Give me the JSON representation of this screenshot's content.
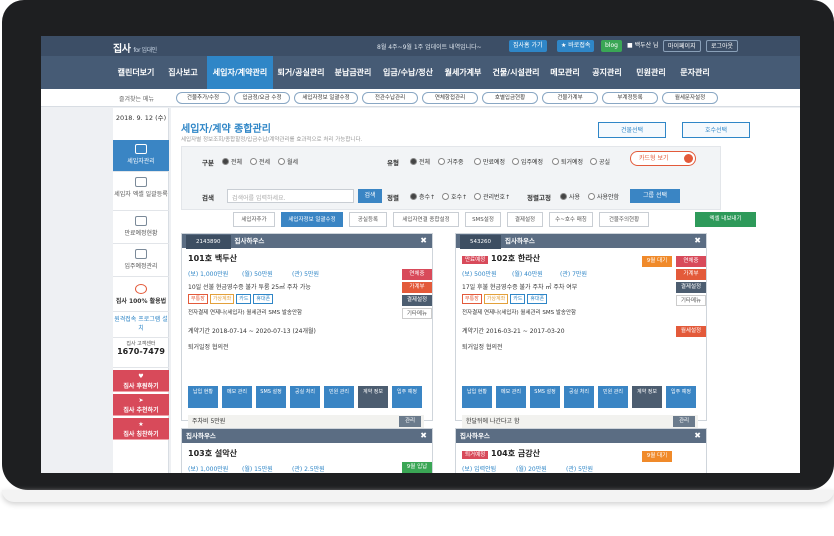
{
  "header": {
    "logo": "집사",
    "logo_sub": "for 임대인",
    "notice": "8월 4주~9월 1주 업데이트 내역입니다~",
    "btn_home": "집사홈 가기",
    "btn_fav": "★ 바로접속",
    "btn_blog": "blog",
    "user": "■ 백두산 님",
    "btn_mypage": "마이페이지",
    "btn_logout": "로그아웃"
  },
  "nav": [
    "캘린더보기",
    "집사보고",
    "세입자/계약관리",
    "퇴거/공실관리",
    "분납금관리",
    "입금/수납/정산",
    "월세가계부",
    "건물/시설관리",
    "메모관리",
    "공지관리",
    "민원관리",
    "문자관리"
  ],
  "subnav": {
    "label": "즐겨찾는 메뉴",
    "items": [
      "건물추가/수정",
      "입금정/요금 수정",
      "세입자정보 일괄수정",
      "전관수납관리",
      "연체항접관리",
      "호별입금현황",
      "건물가계부",
      "부계정등록",
      "월세문자설정"
    ]
  },
  "sidebar": {
    "date": "2018. 9. 12 (수)",
    "items": [
      "세입자관리",
      "세입자 엑셀 일괄등록",
      "만료예정현황",
      "입주예정관리"
    ],
    "app": "집사 100% 활용법",
    "remote": "원격접속 프로그램 설치",
    "center_label": "집사 고객센터",
    "phone": "1670-7479",
    "red": [
      "집사 후원하기",
      "집사 추천하기",
      "집사 칭찬하기"
    ]
  },
  "main": {
    "title": "세입자/계약 종합관리",
    "desc": "세입자별 정보조회/종합할정/입금수납/계약관리를 효과적으로 처리 가능합니다.",
    "btn_building": "건물선택",
    "btn_room": "호수선택",
    "filter": {
      "gubun": "구분",
      "gubun_opts": [
        "전체",
        "전세",
        "월세"
      ],
      "type": "유형",
      "type_opts": [
        "전체",
        "거주중",
        "만료예정",
        "입주예정",
        "퇴거예정",
        "공실"
      ],
      "card_view": "카드형 보기",
      "search": "검색",
      "placeholder": "검색어를 입력하세요.",
      "search_btn": "검색",
      "sort": "정렬",
      "sort_opts": [
        "층수↑",
        "호수↑",
        "관리번호↑"
      ],
      "fix": "정렬고정",
      "fix_opts": [
        "사용",
        "사용안함"
      ],
      "group_btn": "그룹 선택"
    },
    "tabs": [
      "세입자추가",
      "세입자정보 일괄수정",
      "공실등록",
      "세입자연결 종합설정",
      "SMS설정",
      "결제설정",
      "수~호수 매칭",
      "건물주의현황"
    ],
    "excel": "엑셀 내보내기"
  },
  "cards": [
    {
      "num": "2143890",
      "name": "집사하우스",
      "room": "101호",
      "tenant": "백두산",
      "deposit": "(보) 1,000만원",
      "rent": "(월) 50만원",
      "mgmt": "(관) 5만원",
      "detail": "10일 선불 현금영수증 불가 투룸 25㎡ 주차 가능",
      "tags": [
        "무통장",
        "가상계좌",
        "카드",
        "휴대폰"
      ],
      "account": "전자결제 연제나(세입자) 월세관리 SMS 발송안함",
      "period": "계약기간 2018-07-14 ~ 2020-07-13 (24개월)",
      "status": "퇴거일정 협의전",
      "btns": [
        "연체중",
        "가계부",
        "결제설정",
        "기타메뉴"
      ],
      "memo": "주차비 5만원"
    },
    {
      "num": "543260",
      "name": "집사하우스",
      "badge": "만료예정",
      "room": "102호",
      "tenant": "한라산",
      "deposit": "(보) 500만원",
      "rent": "(월) 40만원",
      "mgmt": "(관) 7만원",
      "detail": "17일 후불 현금영수증 불가 주차 ㎡ 주차 여부",
      "tags": [
        "무통장",
        "가상계좌",
        "카드",
        "휴대폰"
      ],
      "account": "전자결제 연제나(세입자) 월세관리 SMS 발송안함",
      "period": "계약기간 2016-03-21 ~ 2017-03-20",
      "status": "퇴거일정 협의전",
      "btns": [
        "연체중",
        "가계부",
        "결제설정",
        "기타메뉴"
      ],
      "extra": "9월 대기",
      "status_badge": "월세설정",
      "memo": "한달뒤에 나간다고 함"
    },
    {
      "num": "",
      "name": "집사하우스",
      "room": "103호",
      "tenant": "설악산",
      "deposit": "(보) 1,000만원",
      "rent": "(월) 15만원",
      "mgmt": "(관) 2.5만원",
      "extra": "9월 입납"
    },
    {
      "num": "",
      "name": "집사하우스",
      "badge": "퇴거예정",
      "room": "104호",
      "tenant": "금강산",
      "deposit": "(보) 입력안됨",
      "rent": "(월) 20만원",
      "mgmt": "(관) 5만원",
      "extra": "9월 대기"
    }
  ],
  "grid_btns": [
    "납입 현황",
    "메모 관리",
    "SMS 설정",
    "공실 처리",
    "민원 관리",
    "계약 정보",
    "입주 예정"
  ],
  "memo_btn": "관리"
}
